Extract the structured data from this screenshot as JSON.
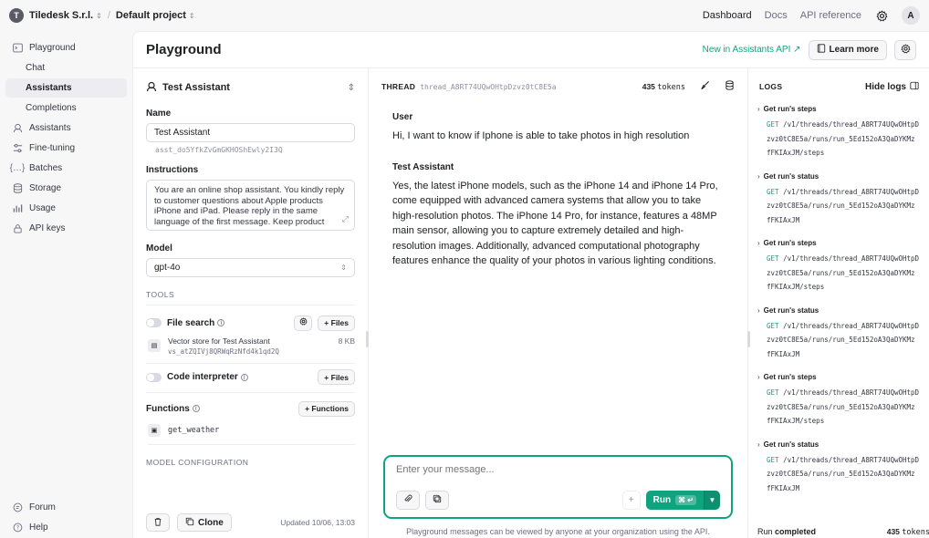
{
  "topbar": {
    "org_initial": "T",
    "org_name": "Tiledesk S.r.l.",
    "project": "Default project",
    "nav": [
      "Dashboard",
      "Docs",
      "API reference"
    ],
    "user_initial": "A"
  },
  "sidebar": {
    "items": [
      {
        "label": "Playground",
        "icon": "terminal-icon"
      },
      {
        "label": "Chat",
        "sub": true
      },
      {
        "label": "Assistants",
        "sub": true,
        "active": true
      },
      {
        "label": "Completions",
        "sub": true
      },
      {
        "label": "Assistants",
        "icon": "robot-icon"
      },
      {
        "label": "Fine-tuning",
        "icon": "sliders-icon"
      },
      {
        "label": "Batches",
        "icon": "braces-icon"
      },
      {
        "label": "Storage",
        "icon": "database-icon"
      },
      {
        "label": "Usage",
        "icon": "chart-icon"
      },
      {
        "label": "API keys",
        "icon": "lock-icon"
      }
    ],
    "bottom": [
      {
        "label": "Forum",
        "icon": "forum-icon"
      },
      {
        "label": "Help",
        "icon": "help-icon"
      }
    ]
  },
  "header": {
    "title": "Playground",
    "new_link": "New in Assistants API ↗",
    "learn_more": "Learn more"
  },
  "assistant": {
    "selector_name": "Test Assistant",
    "name_label": "Name",
    "name_value": "Test Assistant",
    "id": "asst_do5YfkZvGmGKHOShEwly2I3Q",
    "instructions_label": "Instructions",
    "instructions": "You are an online shop assistant. You kindly reply to customer questions about Apple products iPhone and iPad. Please reply in the same language of the first message. Keep product",
    "model_label": "Model",
    "model_value": "gpt-4o",
    "tools_caption": "TOOLS",
    "file_search_label": "File search",
    "files_label": "+ Files",
    "vector_name": "Vector store for Test Assistant",
    "vector_id": "vs_atZQIVj8QRWqRzNfd4k1qd2Q",
    "vector_size": "8 KB",
    "code_interpreter_label": "Code interpreter",
    "code_files_label": "+ Files",
    "functions_label": "Functions",
    "functions_add": "+ Functions",
    "function_name": "get_weather",
    "model_config_caption": "MODEL CONFIGURATION",
    "clone_label": "Clone",
    "updated": "Updated 10/06, 13:03"
  },
  "thread": {
    "caption": "THREAD",
    "id": "thread_A8RT74UQwOHtpDzvz0tC8E5a",
    "tokens_num": "435",
    "tokens_unit": "tokens",
    "messages": [
      {
        "role": "User",
        "text": "Hi, I want to know if Iphone is able to take photos in high resolution"
      },
      {
        "role": "Test Assistant",
        "text": "Yes, the latest iPhone models, such as the iPhone 14 and iPhone 14 Pro, come equipped with advanced camera systems that allow you to take high-resolution photos. The iPhone 14 Pro, for instance, features a 48MP main sensor, allowing you to capture extremely detailed and high-resolution images. Additionally, advanced computational photography features enhance the quality of your photos in various lighting conditions."
      }
    ],
    "composer_placeholder": "Enter your message...",
    "run_label": "Run",
    "run_shortcut": "⌘ ↵",
    "footnote": "Playground messages can be viewed by anyone at your organization using the API."
  },
  "logs": {
    "caption": "LOGS",
    "hide_label": "Hide logs",
    "entries": [
      {
        "title": "Get run's steps",
        "method": "GET",
        "lines": [
          "/v1/threads/thread_A8RT74UQwOHtpD",
          "zvz0tC8E5a/runs/run_5Ed152oA3QaDYKMz",
          "fFKIAxJM/steps"
        ]
      },
      {
        "title": "Get run's status",
        "method": "GET",
        "lines": [
          "/v1/threads/thread_A8RT74UQwOHtpD",
          "zvz0tC8E5a/runs/run_5Ed152oA3QaDYKMz",
          "fFKIAxJM"
        ]
      },
      {
        "title": "Get run's steps",
        "method": "GET",
        "lines": [
          "/v1/threads/thread_A8RT74UQwOHtpD",
          "zvz0tC8E5a/runs/run_5Ed152oA3QaDYKMz",
          "fFKIAxJM/steps"
        ]
      },
      {
        "title": "Get run's status",
        "method": "GET",
        "lines": [
          "/v1/threads/thread_A8RT74UQwOHtpD",
          "zvz0tC8E5a/runs/run_5Ed152oA3QaDYKMz",
          "fFKIAxJM"
        ]
      },
      {
        "title": "Get run's steps",
        "method": "GET",
        "lines": [
          "/v1/threads/thread_A8RT74UQwOHtpD",
          "zvz0tC8E5a/runs/run_5Ed152oA3QaDYKMz",
          "fFKIAxJM/steps"
        ]
      },
      {
        "title": "Get run's status",
        "method": "GET",
        "lines": [
          "/v1/threads/thread_A8RT74UQwOHtpD",
          "zvz0tC8E5a/runs/run_5Ed152oA3QaDYKMz",
          "fFKIAxJM"
        ]
      }
    ],
    "footer_run": "Run",
    "footer_status": "completed",
    "footer_tokens_num": "435",
    "footer_tokens_unit": "tokens"
  },
  "colors": {
    "accent": "#10a37f"
  }
}
